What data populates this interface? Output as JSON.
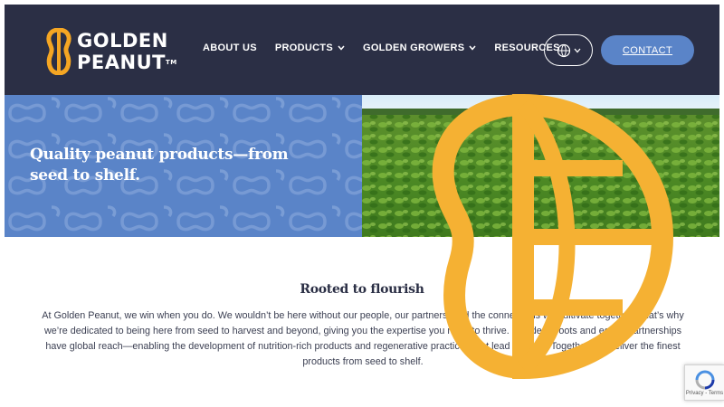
{
  "brand": {
    "line1": "GOLDEN",
    "line2": "PEANUT",
    "tm": "TM",
    "accent_color": "#f5a623",
    "header_bg": "#2b2f45",
    "hero_blue": "#5a84c8"
  },
  "nav": {
    "items": [
      {
        "label": "ABOUT US",
        "has_dropdown": false
      },
      {
        "label": "PRODUCTS",
        "has_dropdown": true
      },
      {
        "label": "GOLDEN GROWERS",
        "has_dropdown": true
      },
      {
        "label": "RESOURCES",
        "has_dropdown": false
      }
    ],
    "globe_icon": "globe-icon",
    "contact_label": "CONTACT"
  },
  "hero": {
    "title": "Quality peanut products—from seed to shelf.",
    "image": "peanut-field-photo"
  },
  "section": {
    "title": "Rooted to flourish",
    "body": "At Golden Peanut, we win when you do. We wouldn’t be here without our people, our partners, and the connections we cultivate together. That’s why we’re dedicated to being here from seed to harvest and beyond, giving you the expertise you need to thrive. Our deep roots and equity partnerships have global reach—enabling the development of nutrition-rich products and regenerative practices that lead the way. Together, we deliver the finest products from seed to shelf."
  },
  "recaptcha": {
    "label": "Privacy - Terms"
  }
}
